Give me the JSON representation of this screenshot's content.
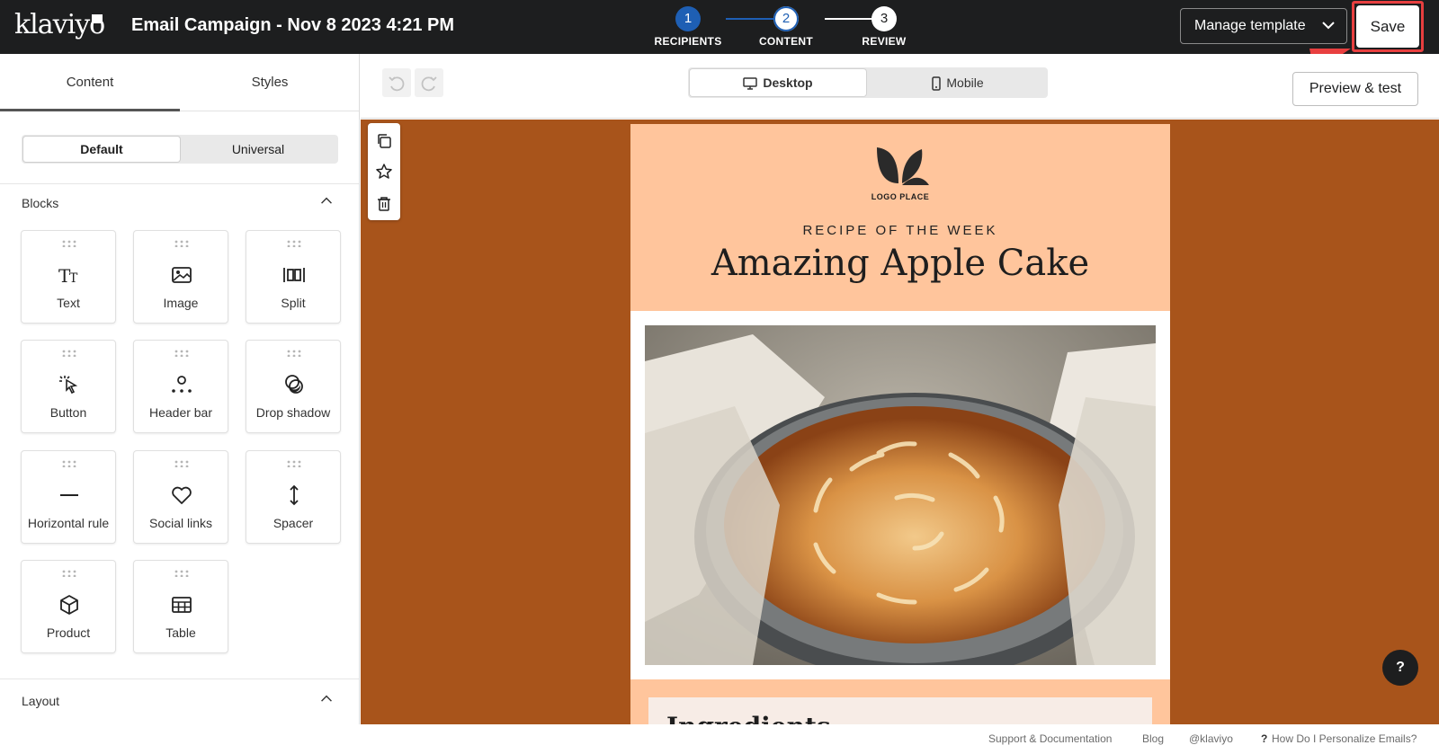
{
  "app": {
    "logo_text": "klaviyo"
  },
  "header": {
    "campaign_title": "Email Campaign - Nov 8 2023 4:21 PM",
    "steps": [
      {
        "number": "1",
        "label": "RECIPIENTS"
      },
      {
        "number": "2",
        "label": "CONTENT"
      },
      {
        "number": "3",
        "label": "REVIEW"
      }
    ],
    "manage_template_label": "Manage template",
    "save_label": "Save"
  },
  "left_panel": {
    "tabs": [
      "Content",
      "Styles"
    ],
    "style_toggle": [
      "Default",
      "Universal"
    ],
    "blocks_heading": "Blocks",
    "blocks": [
      {
        "label": "Text",
        "icon": "text-icon"
      },
      {
        "label": "Image",
        "icon": "image-icon"
      },
      {
        "label": "Split",
        "icon": "split-icon"
      },
      {
        "label": "Button",
        "icon": "cursor-click-icon"
      },
      {
        "label": "Header bar",
        "icon": "header-bar-icon"
      },
      {
        "label": "Drop shadow",
        "icon": "drop-shadow-icon"
      },
      {
        "label": "Horizontal rule",
        "icon": "horizontal-rule-icon"
      },
      {
        "label": "Social links",
        "icon": "heart-icon"
      },
      {
        "label": "Spacer",
        "icon": "spacer-arrows-icon"
      },
      {
        "label": "Product",
        "icon": "cube-icon"
      },
      {
        "label": "Table",
        "icon": "table-icon"
      }
    ],
    "layout_heading": "Layout"
  },
  "toolbar": {
    "devices": [
      "Desktop",
      "Mobile"
    ],
    "preview_label": "Preview & test"
  },
  "email": {
    "logo_text": "LOGO PLACE",
    "kicker": "RECIPE OF THE WEEK",
    "title": "Amazing Apple Cake",
    "section_title": "Ingredients",
    "hero_alt": "apple cake photo"
  },
  "help_label": "?",
  "footer": {
    "links": [
      "Support & Documentation",
      "Blog",
      "@klaviyo",
      "How Do I Personalize Emails?"
    ]
  },
  "colors": {
    "topbar": "#1d1e1f",
    "step_active": "#1e5fb4",
    "canvas_bg": "#a8541b",
    "email_accent": "#ffc59c",
    "save_highlight": "#e83f3f"
  }
}
